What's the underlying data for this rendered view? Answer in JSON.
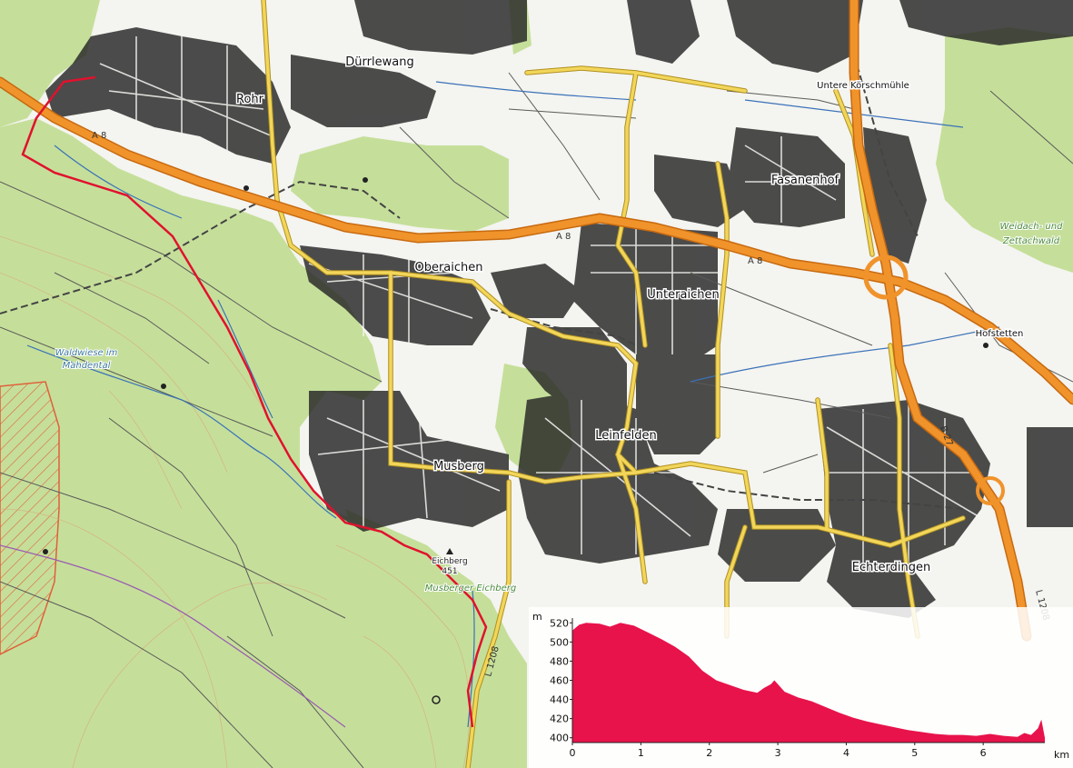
{
  "places": {
    "durrlewang": "Dürrlewang",
    "rohr": "Rohr",
    "untere_korschmuhle": "Untere Körschmühle",
    "fasanenhof": "Fasanenhof",
    "oberaichen": "Oberaichen",
    "unteraichen": "Unteraichen",
    "hofstetten": "Hofstetten",
    "leinfelden": "Leinfelden",
    "musberg": "Musberg",
    "echterdingen": "Echterdingen",
    "weidach_line1": "Weidach- und",
    "weidach_line2": "Zettachwald",
    "waldwiese_line1": "Waldwiese im",
    "waldwiese_line2": "Mahdental",
    "eichberg": "Eichberg",
    "eichberg_elev": "451",
    "musberger_eichberg": "Musberger Eichberg"
  },
  "roads": {
    "a8_west": "A 8",
    "a8_mid": "A 8",
    "a8_east": "A 8",
    "b27": "B 27",
    "l1208_south": "L 1208",
    "l1208_east": "L 1208"
  },
  "colors": {
    "forest": "#c5df9a",
    "motorway": "#f0932b",
    "motorway_casing": "#c76a10",
    "primary_road": "#f2d65a",
    "minor_road": "#5a5a5a",
    "rail": "#444444",
    "route": "#e0122e",
    "stream": "#3a72b8",
    "residential": "#1a1a1a",
    "profile_fill": "#e8134b"
  },
  "profile": {
    "y_unit": "m",
    "x_unit": "km",
    "y_ticks": [
      "520",
      "500",
      "480",
      "460",
      "440",
      "420",
      "400"
    ],
    "x_ticks": [
      "0",
      "1",
      "2",
      "3",
      "4",
      "5",
      "6"
    ],
    "chart_data": {
      "type": "area",
      "xlabel": "km",
      "ylabel": "m",
      "xlim": [
        0,
        6.9
      ],
      "ylim": [
        395,
        525
      ],
      "x": [
        0,
        0.1,
        0.2,
        0.4,
        0.55,
        0.7,
        0.9,
        1.1,
        1.3,
        1.5,
        1.7,
        1.9,
        2.1,
        2.3,
        2.5,
        2.7,
        2.8,
        2.9,
        2.95,
        3.1,
        3.3,
        3.5,
        3.7,
        3.9,
        4.1,
        4.3,
        4.5,
        4.7,
        4.9,
        5.1,
        5.3,
        5.5,
        5.7,
        5.9,
        6.1,
        6.3,
        6.5,
        6.6,
        6.7,
        6.8,
        6.85,
        6.9
      ],
      "y": [
        512,
        518,
        520,
        519,
        516,
        520,
        517,
        510,
        503,
        495,
        485,
        470,
        460,
        455,
        450,
        447,
        452,
        456,
        460,
        448,
        442,
        438,
        432,
        426,
        421,
        417,
        414,
        411,
        408,
        406,
        404,
        403,
        403,
        402,
        404,
        402,
        401,
        405,
        403,
        410,
        419,
        400
      ]
    }
  }
}
